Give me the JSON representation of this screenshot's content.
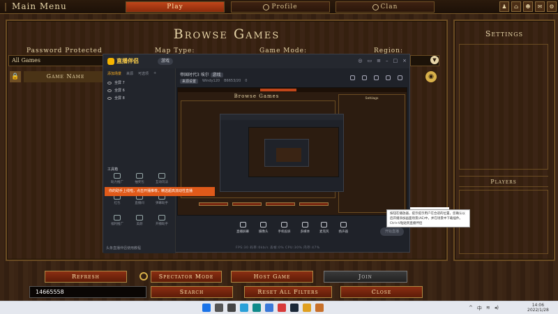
{
  "topbar": {
    "title": "Main Menu",
    "tabs": [
      {
        "label": "Play",
        "active": true
      },
      {
        "label": "Profile",
        "active": false
      },
      {
        "label": "Clan",
        "active": false
      }
    ],
    "icons": [
      "player-icon",
      "hierarchy-icon",
      "group-icon",
      "chat-icon",
      "settings-icon"
    ]
  },
  "browse": {
    "title": "Browse Games",
    "filters": {
      "password_label": "Password Protected",
      "password_value": "All Games",
      "map_label": "Map Type:",
      "mode_label": "Game Mode:",
      "region_label": "Region:"
    },
    "columns": {
      "game_name": "Game Name"
    }
  },
  "side": {
    "title": "Settings",
    "players": "Players"
  },
  "buttons": {
    "refresh": "Refresh",
    "spectator": "Spectator Mode",
    "host": "Host Game",
    "join": "Join",
    "search": "Search",
    "reset": "Reset All Filters",
    "close": "Close"
  },
  "search_value": "14665558",
  "overlay": {
    "app_name": "直播伴侣",
    "pill": "游戏",
    "left_tabs": [
      "添加场景",
      "来源",
      "可选项"
    ],
    "scenes": [
      "全屏 7",
      "全屏 6",
      "全屏 8"
    ],
    "tools_title": "工具箱",
    "tools": [
      "助力推广",
      "抽奖包",
      "互动玩法",
      "红包",
      "直播间",
      "弹幕助手",
      "福利推广",
      "美颜",
      "开播助手"
    ],
    "promo": "你的助手上线啦，点击开播推荐，精选超高流动性直播",
    "main_title": "帝国时代3 埃尔",
    "main_badge": "游戏",
    "sub_items": [
      "来源设置",
      "Windy120",
      "B6653/20",
      "0"
    ],
    "preview_title": "Browse Games",
    "preview_side": "Settings",
    "toolbar": [
      "直播屏幕",
      "摄像头",
      "手机投屏",
      "多媒体",
      "麦克风",
      "扬声器"
    ],
    "start_live": "开始直播",
    "footer": "头条直播伴侣使用教程",
    "status": "FPS:30  码率:0kb/s  丢帧:0%  CPU:30%  内存:47%",
    "tooltip": "按钮在播放器，提示提示用户在合适的位置，您确认以后开播添加画面场景(AE)中，并在场景中下载插件。Ctrl+V粘贴到直播伴侣"
  },
  "taskbar": {
    "icons": [
      "windows-icon",
      "search-icon",
      "task-view-icon",
      "browser-icon",
      "edge-icon",
      "store-icon",
      "app-icon",
      "steam-icon",
      "folder-icon",
      "game-icon"
    ],
    "time": "14:06",
    "date": "2022/1/28"
  }
}
